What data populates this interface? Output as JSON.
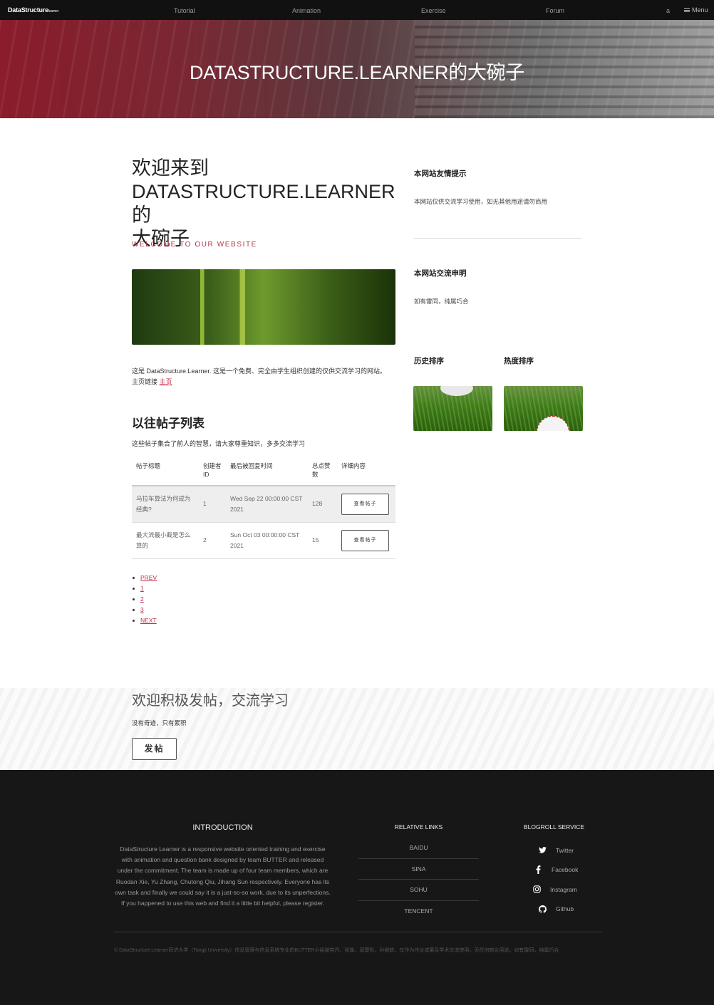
{
  "nav": {
    "brand": "DataStructure",
    "brand_suffix": "learner",
    "links": [
      "Tutorial",
      "Animation",
      "Exercise",
      "Forum"
    ],
    "user": "a",
    "menu_label": "Menu"
  },
  "hero": {
    "title": "DATASTRUCTURE.LEARNER的大碗子"
  },
  "main": {
    "welcome_line1": "欢迎来到",
    "welcome_line2": "DATASTRUCTURE.LEARNER的",
    "welcome_line3": "大碗子",
    "welcome_sub": "WELCOME TO OUR WEBSITE",
    "intro_text": "这是 DataStructure.Learner. 这是一个免费、完全由学生组织创建的仅供交流学习的网站。",
    "intro_link_prefix": "主页链接",
    "intro_link_label": "主页",
    "list_title": "以往帖子列表",
    "list_desc": "这些帖子集合了前人的智慧，请大家尊重知识，多多交流学习",
    "table": {
      "headers": [
        "帖子标题",
        "创建者ID",
        "最后被回复时间",
        "总点赞数",
        "详细内容"
      ],
      "rows": [
        {
          "title": "马拉车算法为何成为经典?",
          "creator": "1",
          "time": "Wed Sep 22 00:00:00 CST 2021",
          "likes": "128",
          "action": "查看帖子"
        },
        {
          "title": "最大流最小截是怎么算的",
          "creator": "2",
          "time": "Sun Oct 03 00:00:00 CST 2021",
          "likes": "15",
          "action": "查看帖子"
        }
      ]
    },
    "pager": [
      "PREV",
      "1",
      "2",
      "3",
      "NEXT"
    ]
  },
  "side": {
    "tip_title": "本网站友情提示",
    "tip_text": "本网站仅供交流学习使用，如无其他用途请勿商用",
    "notice_title": "本网站交流申明",
    "notice_text": "如有雷同，纯属巧合",
    "history_title": "历史排序",
    "hot_title": "热度排序"
  },
  "cta": {
    "title": "欢迎积极发帖，交流学习",
    "sub": "没有奇迹，只有累积",
    "button": "发帖"
  },
  "footer": {
    "intro_title": "INTRODUCTION",
    "intro_text": "DataStructure Learner is a responsive website oriented training and exercise with animation and question bank designed by team BUTTER and released under the commitment. The team is made up of four team members, which are Ruodan Xie, Yu Zhang, Chutong Qiu, Jihang Sun respectively. Everyone has its own task and finally we could say it is a just-so-so work, due to its unperfections. If you happened to use this web and find it a little bit helpful, please register.",
    "links_title": "RELATIVE LINKS",
    "links": [
      "BAIDU",
      "SINA",
      "SOHU",
      "TENCENT"
    ],
    "social_title": "BLOGROLL SERVICE",
    "social": [
      {
        "icon": "twitter-icon",
        "label": "Twitter"
      },
      {
        "icon": "facebook-icon",
        "label": "Facebook"
      },
      {
        "icon": "instagram-icon",
        "label": "Instagram"
      },
      {
        "icon": "github-icon",
        "label": "Github"
      }
    ],
    "copyright": "© DataStructure.Learner同济大学（Tongji University）信息管理与信息系统专业的BUTTER小组谢若丹、张瑜、邱楚彤、孙继航，仅作为作业成果及学术交流使用，无任何商业用途，如有雷同，纯属巧合"
  }
}
